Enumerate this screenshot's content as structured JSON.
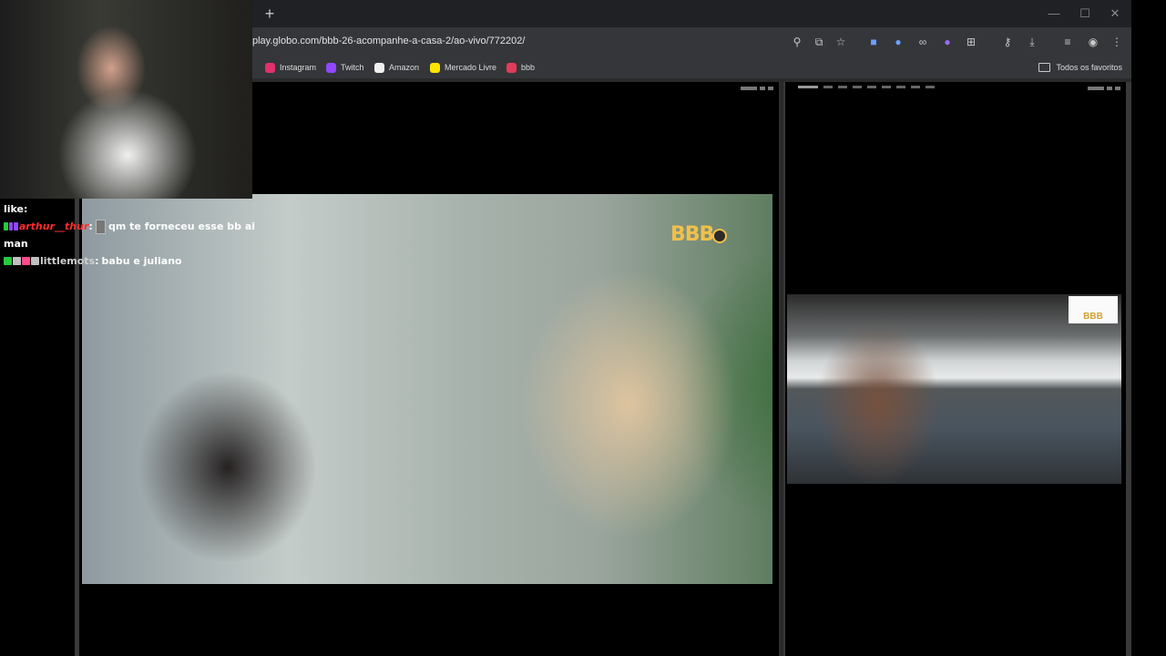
{
  "browser": {
    "new_tab_symbol": "+",
    "window_controls": {
      "minimize": "—",
      "maximize": "☐",
      "close": "✕"
    },
    "address": "play.globo.com/bbb-26-acompanhe-a-casa-2/ao-vivo/772202/",
    "toolbar_icons": [
      "zoom-icon",
      "install-app-icon",
      "bookmark-star-icon",
      "translate-extension-icon",
      "extension-icon",
      "extension-icon",
      "extension-icon",
      "extensions-puzzle-icon",
      "password-key-icon",
      "download-icon",
      "reading-list-icon",
      "profile-icon",
      "menu-icon"
    ],
    "bookmarks": [
      {
        "label": "Instagram",
        "color": "#e1306c"
      },
      {
        "label": "Twitch",
        "color": "#9147ff"
      },
      {
        "label": "Amazon",
        "color": "#f0f0f0"
      },
      {
        "label": "Mercado Livre",
        "color": "#ffe600"
      },
      {
        "label": "bbb",
        "color": "#e23b5a"
      }
    ],
    "all_bookmarks": "Todos os favoritos"
  },
  "players": {
    "main_logo": "BBB",
    "side_logo": "BBB"
  },
  "chat": {
    "top_line": "like:",
    "messages": [
      {
        "user": "arthur__thur",
        "text": "qm te forneceu esse bb ai"
      },
      {
        "user": "",
        "text": "man"
      },
      {
        "user": "littlemots",
        "text": "babu e juliano"
      }
    ]
  },
  "colors": {
    "chrome_dark": "#202124",
    "toolbar": "#35363a",
    "bbb_gold": "#f1c04a"
  }
}
